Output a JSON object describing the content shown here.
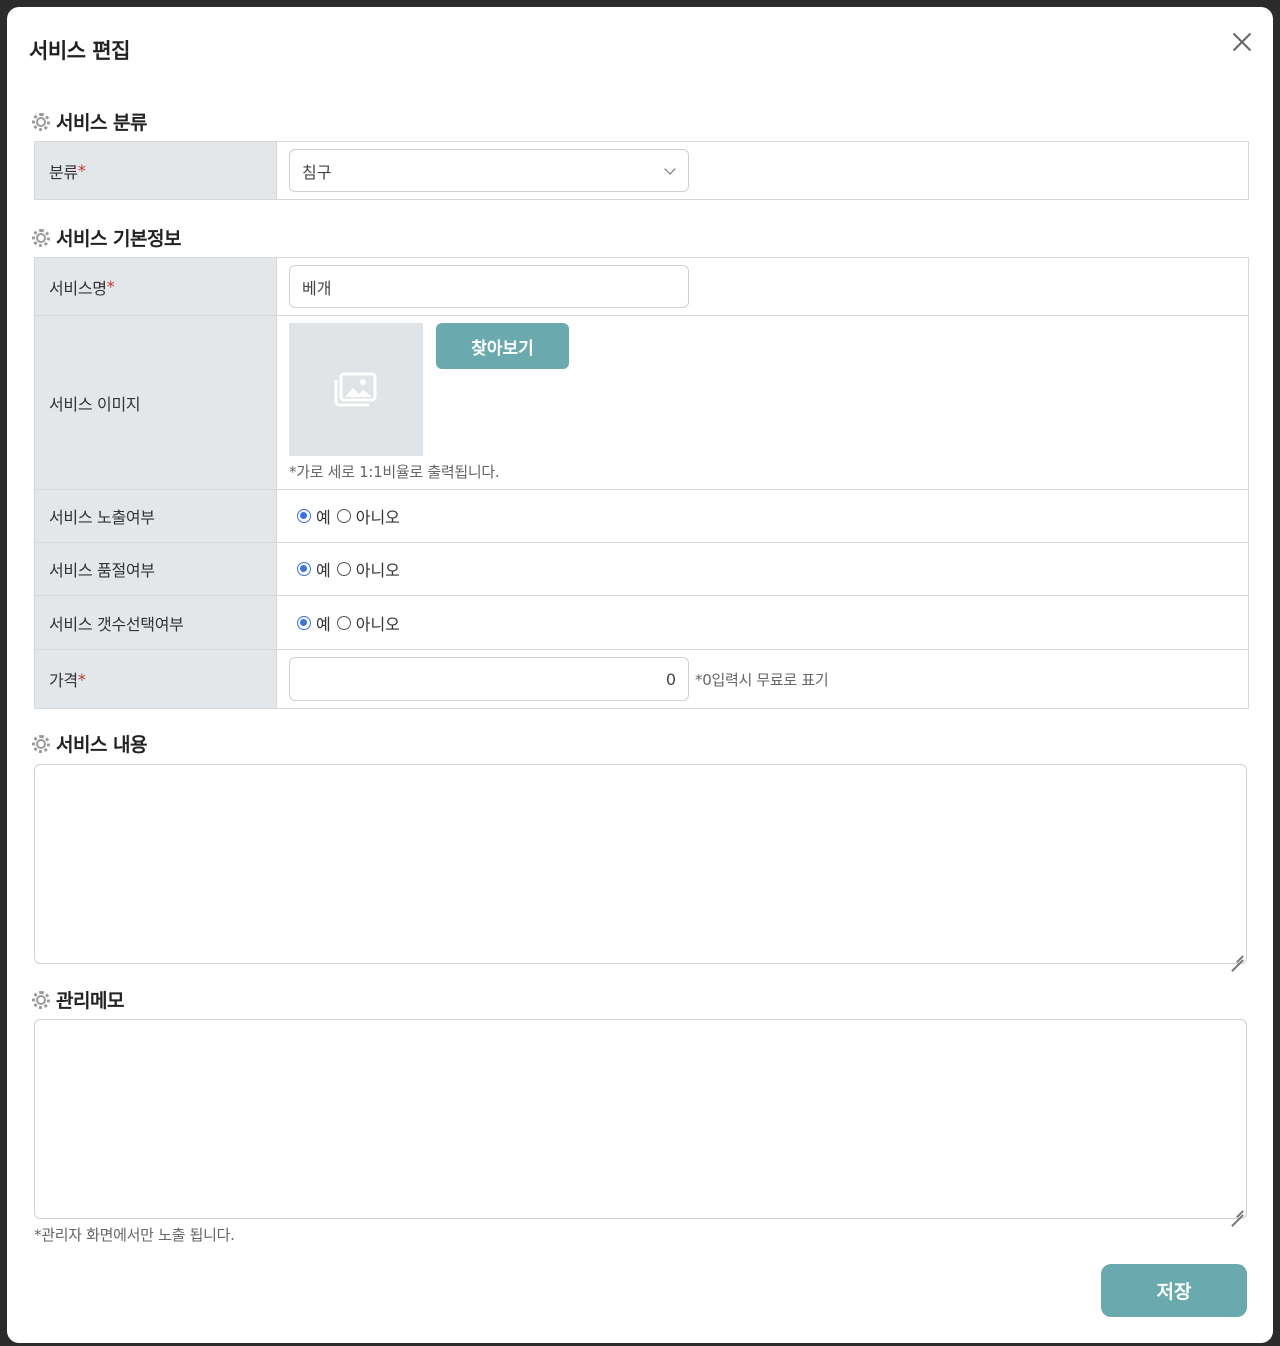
{
  "modal": {
    "title": "서비스 편집",
    "save_label": "저장"
  },
  "sections": {
    "category": "서비스 분류",
    "basic_info": "서비스 기본정보",
    "content": "서비스 내용",
    "memo": "관리메모"
  },
  "category": {
    "label": "분류",
    "required_mark": "*",
    "selected": "침구"
  },
  "basic": {
    "name_label": "서비스명",
    "name_required": "*",
    "name_value": "베개",
    "image_label": "서비스 이미지",
    "browse_label": "찾아보기",
    "image_hint": "*가로 세로 1:1비율로 출력됩니다.",
    "visible_label": "서비스 노출여부",
    "soldout_label": "서비스 품절여부",
    "qty_label": "서비스 갯수선택여부",
    "yes": "예",
    "no": "아니오",
    "visible_selected": "예",
    "soldout_selected": "예",
    "qty_selected": "예",
    "price_label": "가격",
    "price_required": "*",
    "price_value": "0",
    "price_hint": "*0입력시 무료로 표기"
  },
  "memo": {
    "note": "*관리자 화면에서만 노출 됩니다."
  },
  "colors": {
    "accent": "#6aa9ad",
    "radio": "#3b71e0",
    "header_cell": "#e3e7ea"
  }
}
